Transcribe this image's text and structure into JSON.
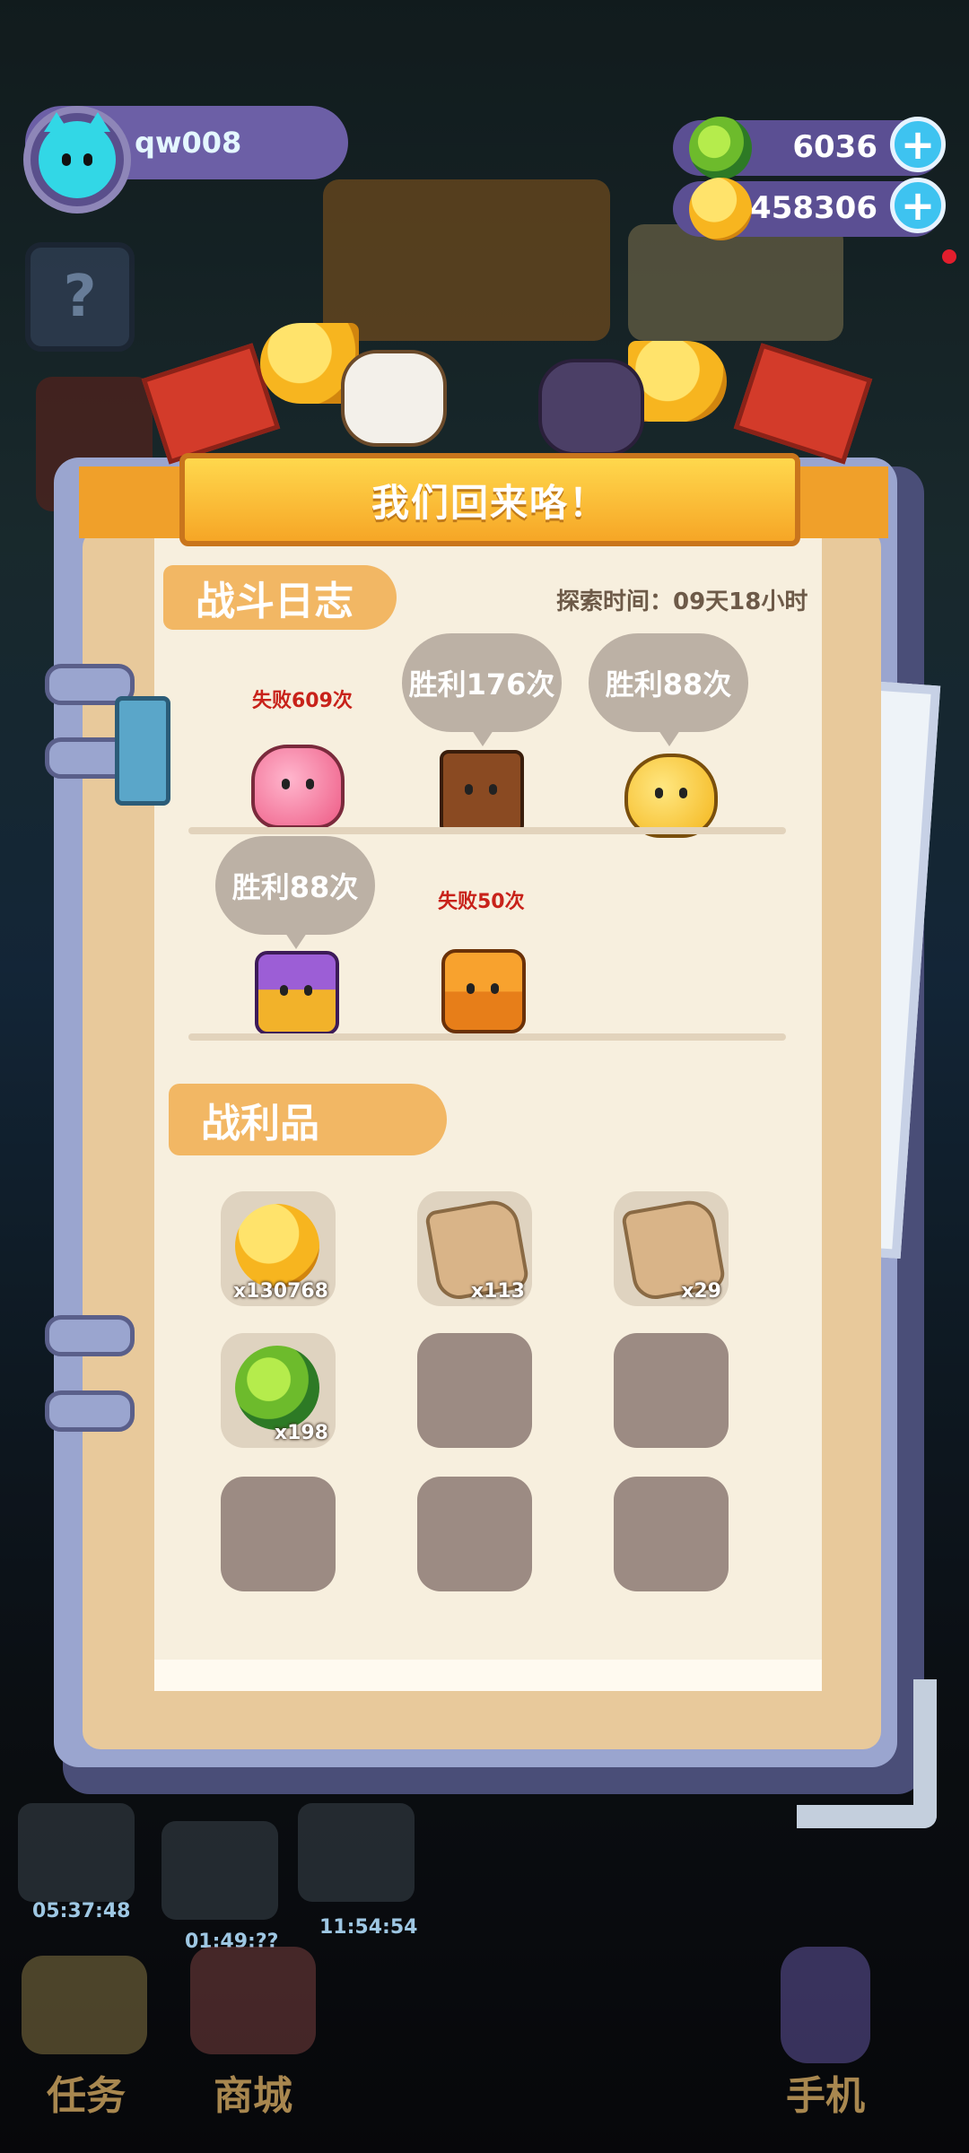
{
  "topbar": {
    "username": "qw008",
    "gems": "6036",
    "coins": "1458306",
    "help_symbol": "?"
  },
  "dialog": {
    "title": "我们回来咯！",
    "battle_log_title": "战斗日志",
    "explore_time": "探索时间：09天18小时",
    "battle_results": [
      {
        "result": "失败609次",
        "outcome": "fail",
        "monster": "pink-blob-monster"
      },
      {
        "result": "胜利176次",
        "outcome": "win",
        "monster": "wooden-box-monster"
      },
      {
        "result": "胜利88次",
        "outcome": "win",
        "monster": "yellow-blob-monster"
      },
      {
        "result": "胜利88次",
        "outcome": "win",
        "monster": "purple-chest-monster"
      },
      {
        "result": "失败50次",
        "outcome": "fail",
        "monster": "orange-crown-chest-monster"
      }
    ],
    "loot_title": "战利品",
    "loot": [
      {
        "icon": "gold-coin-icon",
        "qty": "x130768"
      },
      {
        "icon": "map-scroll-icon",
        "qty": "x113"
      },
      {
        "icon": "map-scroll-icon",
        "qty": "x29"
      },
      {
        "icon": "green-gem-icon",
        "qty": "x198"
      }
    ],
    "empty_slots": 5
  },
  "bottom_nav": {
    "timers": [
      "05:37:48",
      "01:49:??",
      "11:54:54"
    ],
    "tasks_label": "任务",
    "shop_label": "商城",
    "phone_label": "手机"
  },
  "colors": {
    "banner": "#f6a626",
    "section_tag": "#f2b764",
    "fail_text": "#c8221a",
    "bubble": "#bcb1a5",
    "page": "#f7efde"
  }
}
